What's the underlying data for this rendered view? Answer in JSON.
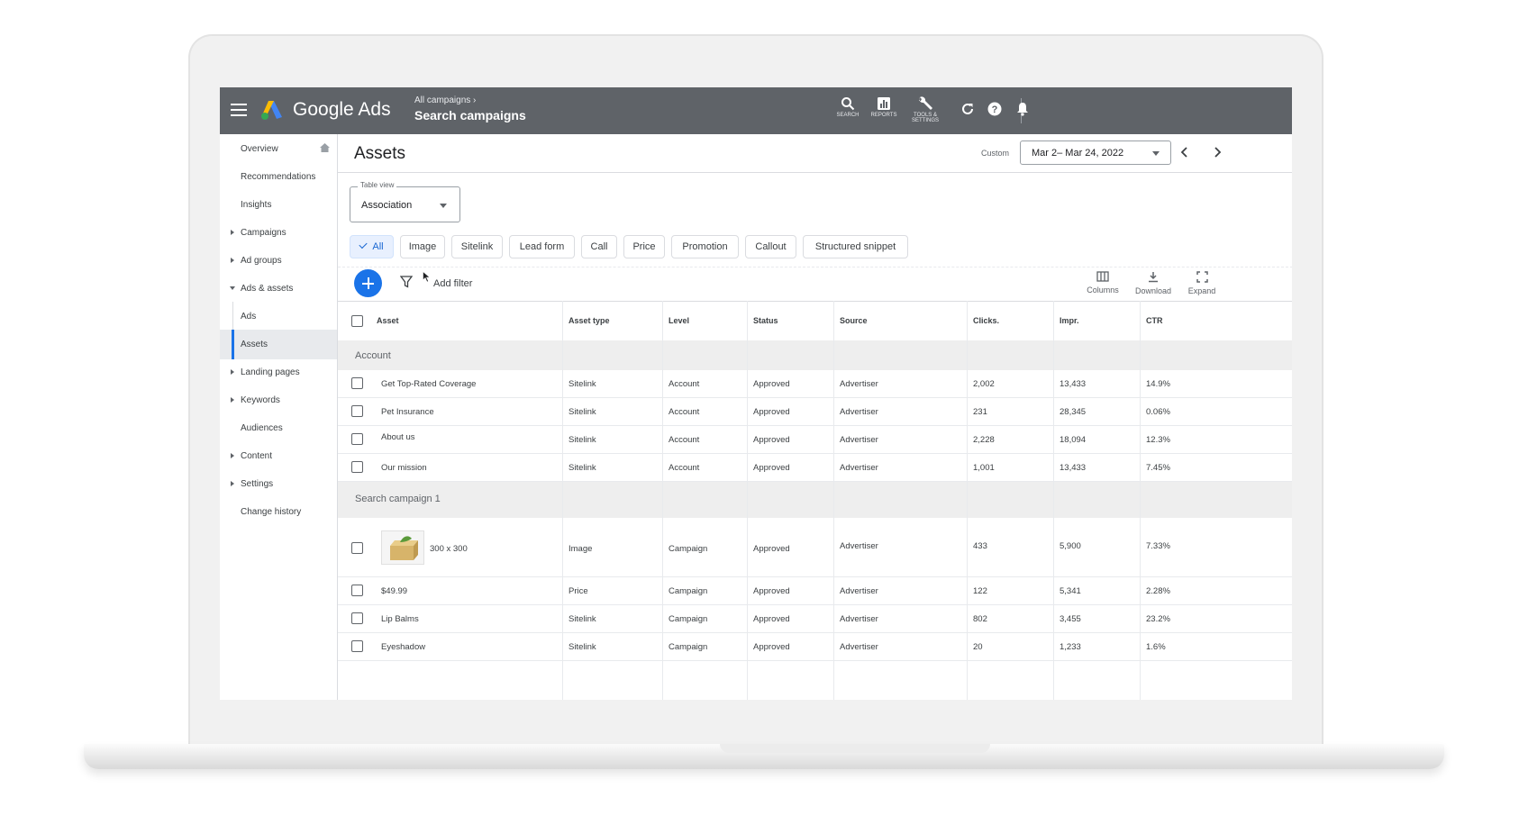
{
  "topbar": {
    "brand": "Google Ads",
    "breadcrumb_parent": "All campaigns",
    "breadcrumb_current": "Search campaigns",
    "tools": {
      "search": "SEARCH",
      "reports": "REPORTS",
      "tools_l1": "TOOLS &",
      "tools_l2": "SETTINGS"
    }
  },
  "sidebar": {
    "items": [
      {
        "label": "Overview"
      },
      {
        "label": "Recommendations"
      },
      {
        "label": "Insights"
      },
      {
        "label": "Campaigns"
      },
      {
        "label": "Ad groups"
      },
      {
        "label": "Ads & assets"
      },
      {
        "label": "Ads"
      },
      {
        "label": "Assets"
      },
      {
        "label": "Landing pages"
      },
      {
        "label": "Keywords"
      },
      {
        "label": "Audiences"
      },
      {
        "label": "Content"
      },
      {
        "label": "Settings"
      },
      {
        "label": "Change history"
      }
    ]
  },
  "header": {
    "title": "Assets",
    "custom_label": "Custom",
    "date_range": "Mar 2– Mar 24, 2022"
  },
  "table_view": {
    "label": "Table view",
    "value": "Association"
  },
  "chips": [
    "All",
    "Image",
    "Sitelink",
    "Lead form",
    "Call",
    "Price",
    "Promotion",
    "Callout",
    "Structured snippet"
  ],
  "toolbar": {
    "add_filter": "Add filter",
    "columns": "Columns",
    "download": "Download",
    "expand": "Expand"
  },
  "columns": [
    "Asset",
    "Asset type",
    "Level",
    "Status",
    "Source",
    "Clicks.",
    "Impr.",
    "CTR"
  ],
  "groups": [
    {
      "name": "Account",
      "rows": [
        {
          "asset": "Get Top-Rated Coverage",
          "type": "Sitelink",
          "level": "Account",
          "status": "Approved",
          "source": "Advertiser",
          "clicks": "2,002",
          "impr": "13,433",
          "ctr": "14.9%"
        },
        {
          "asset": "Pet Insurance",
          "type": "Sitelink",
          "level": "Account",
          "status": "Approved",
          "source": "Advertiser",
          "clicks": "231",
          "impr": "28,345",
          "ctr": "0.06%"
        },
        {
          "asset": "About us",
          "type": "Sitelink",
          "level": "Account",
          "status": "Approved",
          "source": "Advertiser",
          "clicks": "2,228",
          "impr": "18,094",
          "ctr": "12.3%"
        },
        {
          "asset": "Our mission",
          "type": "Sitelink",
          "level": "Account",
          "status": "Approved",
          "source": "Advertiser",
          "clicks": "1,001",
          "impr": "13,433",
          "ctr": "7.45%"
        }
      ]
    },
    {
      "name": "Search campaign 1",
      "rows": [
        {
          "asset": "300 x 300",
          "type": "Image",
          "level": "Campaign",
          "status": "Approved",
          "source": "Advertiser",
          "clicks": "433",
          "impr": "5,900",
          "ctr": "7.33%"
        },
        {
          "asset": "$49.99",
          "type": "Price",
          "level": "Campaign",
          "status": "Approved",
          "source": "Advertiser",
          "clicks": "122",
          "impr": "5,341",
          "ctr": "2.28%"
        },
        {
          "asset": "Lip Balms",
          "type": "Sitelink",
          "level": "Campaign",
          "status": "Approved",
          "source": "Advertiser",
          "clicks": "802",
          "impr": "3,455",
          "ctr": "23.2%"
        },
        {
          "asset": "Eyeshadow",
          "type": "Sitelink",
          "level": "Campaign",
          "status": "Approved",
          "source": "Advertiser",
          "clicks": "20",
          "impr": "1,233",
          "ctr": "1.6%"
        }
      ]
    }
  ],
  "colors": {
    "topbar": "#5f6368",
    "accent": "#1a73e8",
    "group_bg": "#eeeeee"
  }
}
